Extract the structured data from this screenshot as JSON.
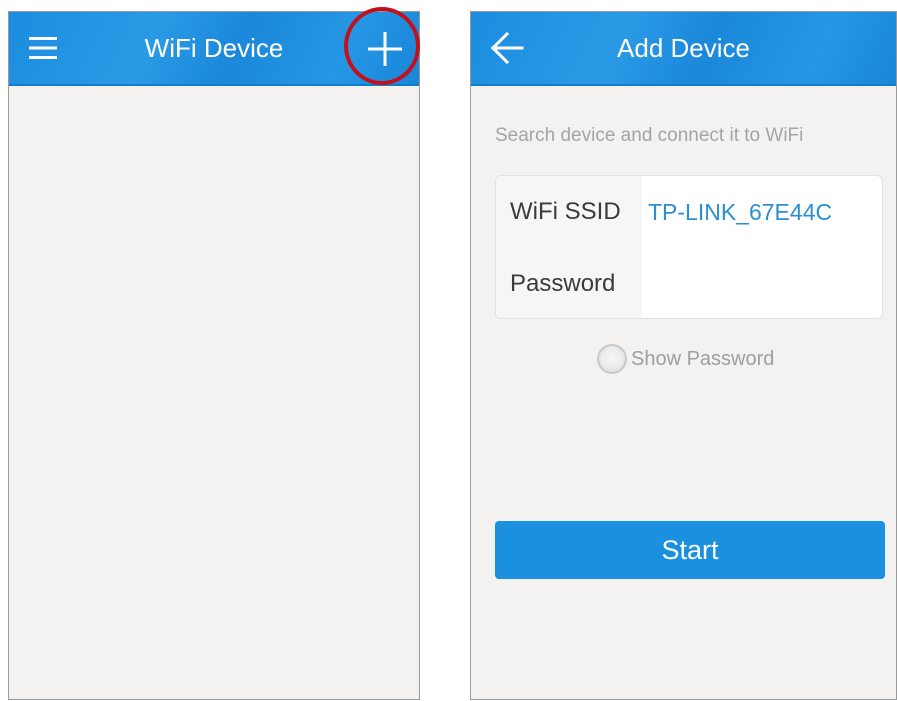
{
  "device_list_screen": {
    "title": "WiFi Device",
    "menu_icon": "hamburger-menu-icon",
    "add_icon": "plus-icon",
    "highlight_color": "#c3111b"
  },
  "add_device_screen": {
    "title": "Add Device",
    "back_icon": "arrow-left-icon",
    "hint": "Search device and connect it to WiFi",
    "ssid_label": "WiFi SSID",
    "ssid_value": "TP-LINK_67E44C",
    "password_label": "Password",
    "password_value": "",
    "show_password_label": "Show Password",
    "start_label": "Start"
  },
  "colors": {
    "appbar": "#1c8ddf",
    "accent_text": "#2b8fd1",
    "button": "#1a90de",
    "background": "#f3f2f0"
  }
}
